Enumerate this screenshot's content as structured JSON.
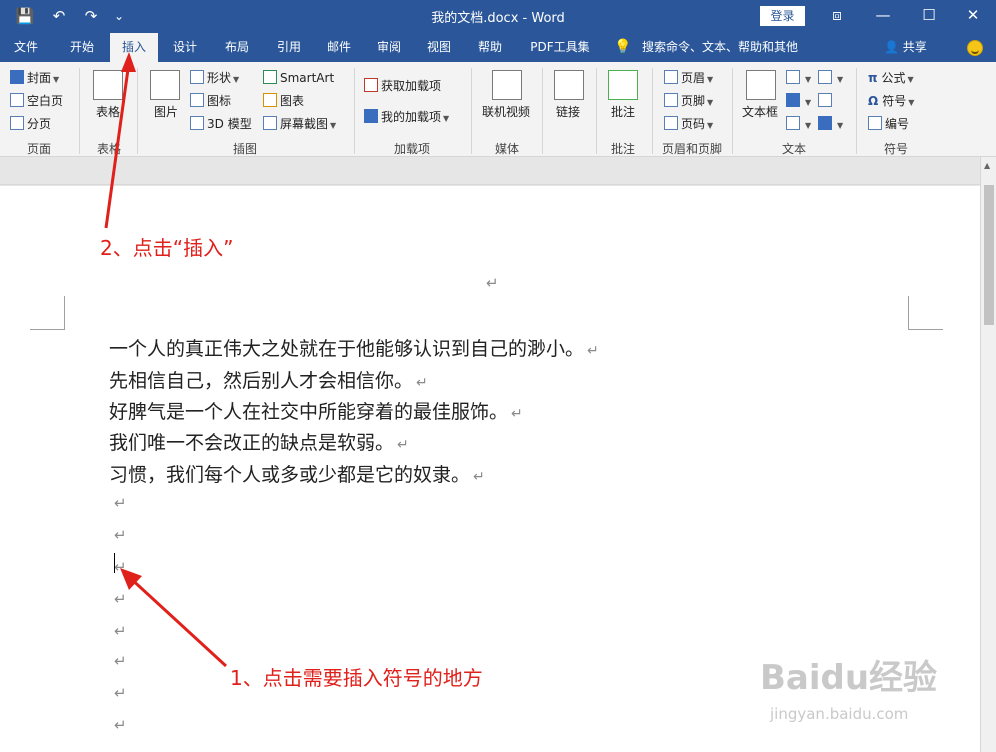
{
  "titlebar": {
    "doc_title": "我的文档.docx  -  Word",
    "login_label": "登录",
    "qat": {
      "save": "💾",
      "undo": "↶",
      "redo": "↷",
      "more": "⌄"
    },
    "window": {
      "ribbon_opts": "⧈",
      "minimize": "—",
      "restore": "☐",
      "close": "✕"
    }
  },
  "tabs": [
    "文件",
    "开始",
    "插入",
    "设计",
    "布局",
    "引用",
    "邮件",
    "审阅",
    "视图",
    "帮助",
    "PDF工具集"
  ],
  "active_tab": "插入",
  "tell_me": "搜索命令、文本、帮助和其他",
  "share_label": "共享",
  "ribbon": {
    "pages": {
      "items": [
        "封面",
        "空白页",
        "分页"
      ],
      "label": "页面"
    },
    "tables": {
      "button": "表格",
      "label": "表格"
    },
    "illustrations": {
      "picture": "图片",
      "shapes": "形状",
      "icons": "图标",
      "model3d": "3D 模型",
      "smartart": "SmartArt",
      "chart": "图表",
      "screenshot": "屏幕截图",
      "label": "插图"
    },
    "addins": {
      "get": "获取加载项",
      "mine": "我的加载项",
      "label": "加载项"
    },
    "media": {
      "video": "联机视频",
      "label": "媒体"
    },
    "links": {
      "link": "链接"
    },
    "comments": {
      "comment": "批注",
      "label": "批注"
    },
    "headerfooter": {
      "header": "页眉",
      "footer": "页脚",
      "pagenum": "页码",
      "label": "页眉和页脚"
    },
    "text": {
      "textbox": "文本框",
      "label": "文本"
    },
    "symbols": {
      "equation": "公式",
      "symbol": "符号",
      "number": "编号",
      "label": "符号"
    }
  },
  "document": {
    "paragraphs": [
      "一个人的真正伟大之处就在于他能够认识到自己的渺小。",
      "先相信自己，然后别人才会相信你。",
      "好脾气是一个人在社交中所能穿着的最佳服饰。",
      "我们唯一不会改正的缺点是软弱。",
      "习惯，我们每个人或多或少都是它的奴隶。"
    ],
    "paragraph_mark": "↵"
  },
  "annotations": {
    "step1": "1、点击需要插入符号的地方",
    "step2": "2、点击“插入”",
    "color": "#e0201b"
  },
  "watermark": {
    "brand": "Baidu经验",
    "url": "jingyan.baidu.com"
  },
  "colors": {
    "word_blue": "#2b579a",
    "ribbon_bg": "#f3f3f3"
  }
}
